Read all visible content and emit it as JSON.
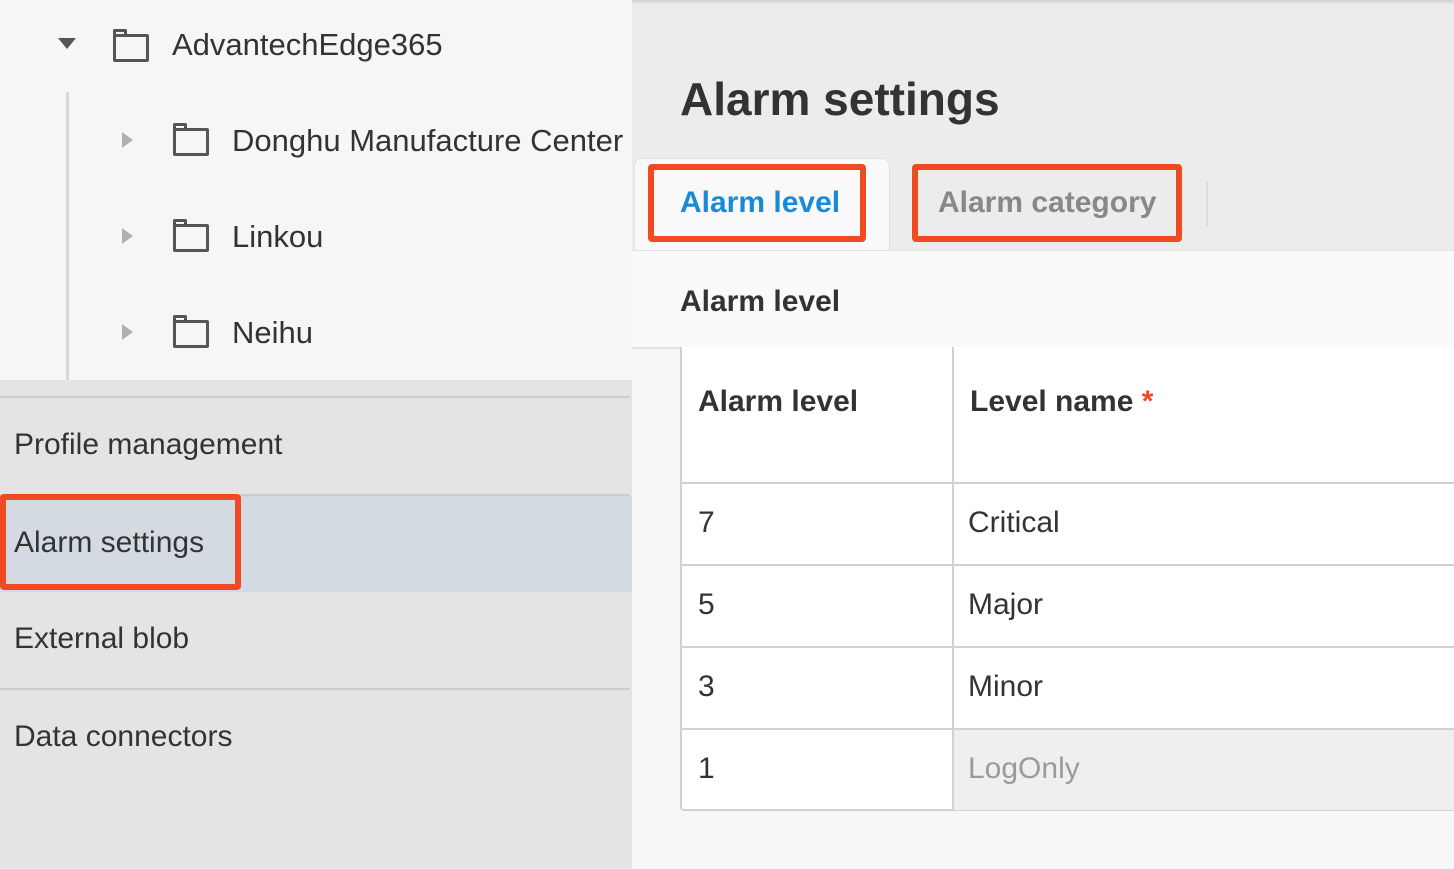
{
  "tree": {
    "root": {
      "label": "AdvantechEdge365",
      "expanded": true
    },
    "children": [
      {
        "label": "Donghu Manufacture Center"
      },
      {
        "label": "Linkou"
      },
      {
        "label": "Neihu"
      }
    ]
  },
  "nav": {
    "items": [
      {
        "label": "Profile management"
      },
      {
        "label": "Alarm settings",
        "active": true
      },
      {
        "label": "External blob"
      },
      {
        "label": "Data connectors"
      }
    ]
  },
  "main": {
    "title": "Alarm settings",
    "tabs": [
      {
        "label": "Alarm level",
        "active": true
      },
      {
        "label": "Alarm category",
        "active": false
      }
    ],
    "panel_title": "Alarm level",
    "table": {
      "headers": {
        "level": "Alarm level",
        "name": "Level name",
        "required_mark": "*"
      },
      "rows": [
        {
          "level": "7",
          "name": "Critical"
        },
        {
          "level": "5",
          "name": "Major"
        },
        {
          "level": "3",
          "name": "Minor"
        },
        {
          "level": "1",
          "name": "LogOnly",
          "disabled": true
        }
      ]
    }
  },
  "colors": {
    "highlight": "#f04a23",
    "active_tab": "#1a8ad8",
    "inactive_tab": "#888888",
    "active_nav_bg": "#d3dae2"
  }
}
